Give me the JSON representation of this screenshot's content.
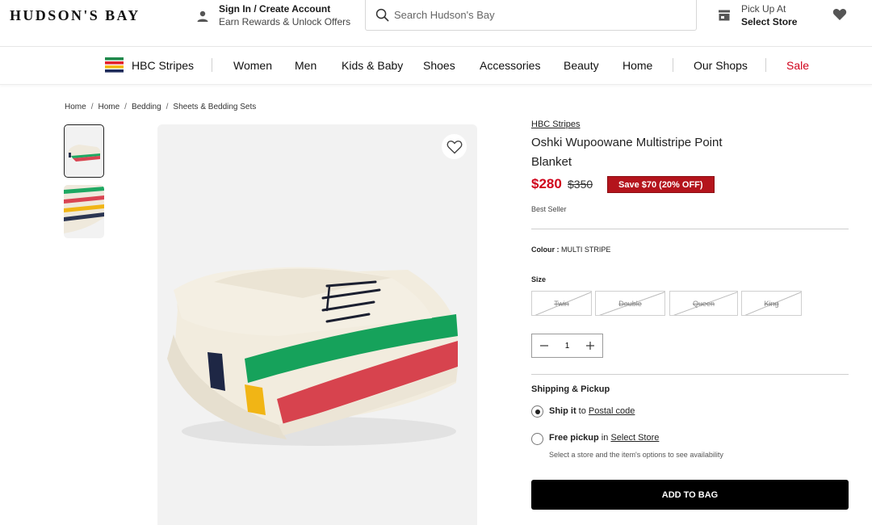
{
  "header": {
    "logo": "HUDSON'S BAY",
    "account_line1": "Sign In / Create Account",
    "account_line2": "Earn Rewards & Unlock Offers",
    "search_placeholder": "Search Hudson's Bay",
    "store_line1": "Pick Up At",
    "store_line2": "Select Store"
  },
  "nav": {
    "items": [
      "HBC Stripes",
      "Women",
      "Men",
      "Kids & Baby",
      "Shoes",
      "Accessories",
      "Beauty",
      "Home",
      "Our Shops",
      "Sale"
    ],
    "sale_color": "#d0021b"
  },
  "breadcrumb": [
    "Home",
    "Home",
    "Bedding",
    "Sheets & Bedding Sets"
  ],
  "product": {
    "brand": "HBC Stripes",
    "title": "Oshki Wupoowane Multistripe Point Blanket",
    "price": "$280",
    "was_price": "$350",
    "save_badge": "Save $70 (20% OFF)",
    "best_seller": "Best Seller",
    "colour_label": "Colour :",
    "colour_value": "MULTI STRIPE",
    "size_label": "Size",
    "sizes": [
      "Twin",
      "Double",
      "Queen",
      "King"
    ],
    "quantity": "1",
    "minus_icon": "minus-icon",
    "plus_icon": "plus-icon"
  },
  "shipping": {
    "heading": "Shipping & Pickup",
    "ship_bold": "Ship it",
    "ship_mid": " to ",
    "ship_link": "Postal code",
    "pickup_bold": "Free pickup",
    "pickup_mid": " in ",
    "pickup_link": "Select Store",
    "pickup_hint": "Select a store and the item's options to see availability"
  },
  "cta": {
    "add_to_bag": "ADD TO BAG"
  },
  "colors": {
    "accent_red": "#d0021b",
    "badge_red": "#b4141c",
    "button_black": "#000000"
  }
}
